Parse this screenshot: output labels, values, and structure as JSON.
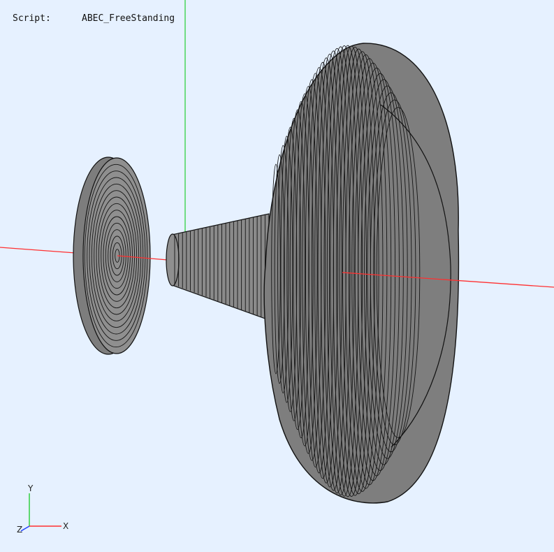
{
  "header": {
    "script_label": "Script:",
    "script_value": "ABEC_FreeStanding"
  },
  "axis_triad": {
    "x_label": "X",
    "y_label": "Y",
    "z_label": "Z"
  },
  "colors": {
    "background": "#e6f1ff",
    "x_axis": "#ff3030",
    "y_axis": "#30d040",
    "z_axis": "#2040ff",
    "mesh_fill": "#8c8c8c",
    "mesh_lines": "#111111"
  }
}
